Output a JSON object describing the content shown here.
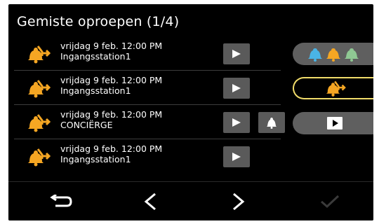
{
  "header": {
    "title": "Gemiste oproepen (1/4)"
  },
  "calls": [
    {
      "date": "vrijdag 9 feb. 12:00 PM",
      "station": "Ingangsstation1",
      "has_bell": false
    },
    {
      "date": "vrijdag 9 feb. 12:00 PM",
      "station": "Ingangsstation1",
      "has_bell": false
    },
    {
      "date": "vrijdag 9 feb. 12:00 PM",
      "station": "CONCIËRGE",
      "has_bell": true
    },
    {
      "date": "vrijdag 9 feb. 12:00 PM",
      "station": "Ingangsstation1",
      "has_bell": false
    }
  ],
  "side_buttons": [
    {
      "icon": "three-bells-icon",
      "active": false
    },
    {
      "icon": "missed-call-icon",
      "active": true
    },
    {
      "icon": "play-icon",
      "active": false
    }
  ],
  "footer": {
    "back_icon": "back-arrow-icon",
    "prev_icon": "chevron-left-icon",
    "next_icon": "chevron-right-icon",
    "ok_icon": "checkmark-icon"
  },
  "colors": {
    "accent_orange": "#f5a623",
    "active_outline": "#f1dc6a",
    "button_gray": "#5a5a5a",
    "bell_blue": "#4ab4e6",
    "bell_green": "#8fc893"
  }
}
